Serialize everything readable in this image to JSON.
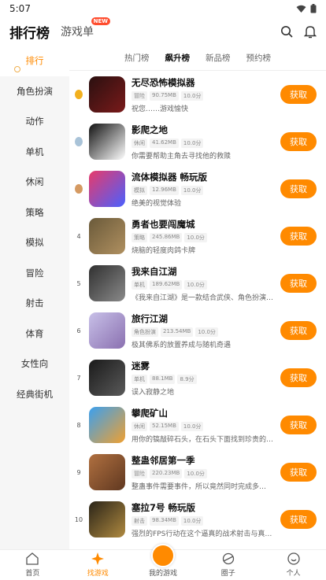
{
  "status": {
    "time": "5:07"
  },
  "header": {
    "title": "排行榜",
    "second_tab": "游戏单",
    "badge": "NEW"
  },
  "sidebar": {
    "items": [
      "排行",
      "角色扮演",
      "动作",
      "单机",
      "休闲",
      "策略",
      "模拟",
      "冒险",
      "射击",
      "体育",
      "女性向",
      "经典街机"
    ]
  },
  "subtabs": [
    "热门榜",
    "飙升榜",
    "新品榜",
    "预约榜"
  ],
  "get_label": "获取",
  "apps": [
    {
      "rank": "",
      "medal": "#f2b01e",
      "name": "无尽恐怖模拟器",
      "tags": [
        "冒险",
        "90.75MB",
        "10.0分"
      ],
      "desc": "祝您……游戏愉快",
      "colors": [
        "#2a1010",
        "#7a1a1a"
      ]
    },
    {
      "rank": "",
      "medal": "#a9c3d8",
      "name": "影爬之地",
      "tags": [
        "休闲",
        "41.62MB",
        "10.0分"
      ],
      "desc": "你需要帮助主角去寻找他的救赎",
      "colors": [
        "#111111",
        "#ffffff"
      ]
    },
    {
      "rank": "",
      "medal": "#d59a62",
      "name": "流体模拟器 畅玩版",
      "tags": [
        "模拟",
        "12.96MB",
        "10.0分"
      ],
      "desc": "绝美的视觉体验",
      "colors": [
        "#e83a6a",
        "#4a60ff"
      ]
    },
    {
      "rank": "4",
      "medal": "",
      "name": "勇者也要闯魔城",
      "tags": [
        "策略",
        "245.86MB",
        "10.0分"
      ],
      "desc": "烧脑的轻度肉鸽卡牌",
      "colors": [
        "#6a5a3a",
        "#b09060"
      ]
    },
    {
      "rank": "5",
      "medal": "",
      "name": "我来自江湖",
      "tags": [
        "单机",
        "189.62MB",
        "10.0分"
      ],
      "desc": "《我来自江湖》是一款结合武侠、角色扮演…",
      "colors": [
        "#303030",
        "#8a8a8a"
      ]
    },
    {
      "rank": "6",
      "medal": "",
      "name": "旅行江湖",
      "tags": [
        "角色扮演",
        "213.54MB",
        "10.0分"
      ],
      "desc": "极其佛系的放置养成与随机奇遇",
      "colors": [
        "#c8c0e8",
        "#8a70b0"
      ]
    },
    {
      "rank": "7",
      "medal": "",
      "name": "迷雾",
      "tags": [
        "单机",
        "88.1MB",
        "8.9分"
      ],
      "desc": "误入寂静之地",
      "colors": [
        "#1a1a1a",
        "#5a5a5a"
      ]
    },
    {
      "rank": "8",
      "medal": "",
      "name": "攀爬矿山",
      "tags": [
        "休闲",
        "52.15MB",
        "10.0分"
      ],
      "desc": "用你的镐敲碎石头，在石头下面找到珍贵的…",
      "colors": [
        "#3aa0f0",
        "#f0a030"
      ]
    },
    {
      "rank": "9",
      "medal": "",
      "name": "整蛊邻居第一季",
      "tags": [
        "冒险",
        "220.23MB",
        "10.0分"
      ],
      "desc": "整蛊事件需要事件，所以竟然同时完成多…",
      "colors": [
        "#b07040",
        "#603820"
      ]
    },
    {
      "rank": "10",
      "medal": "",
      "name": "塞拉7号 畅玩版",
      "tags": [
        "射击",
        "98.34MB",
        "10.0分"
      ],
      "desc": "强烈的FPS行动在这个逼真的战术射击与真…",
      "colors": [
        "#2a2418",
        "#b08a40"
      ]
    }
  ],
  "bottomnav": [
    "首页",
    "找游戏",
    "我的游戏",
    "圈子",
    "个人"
  ]
}
